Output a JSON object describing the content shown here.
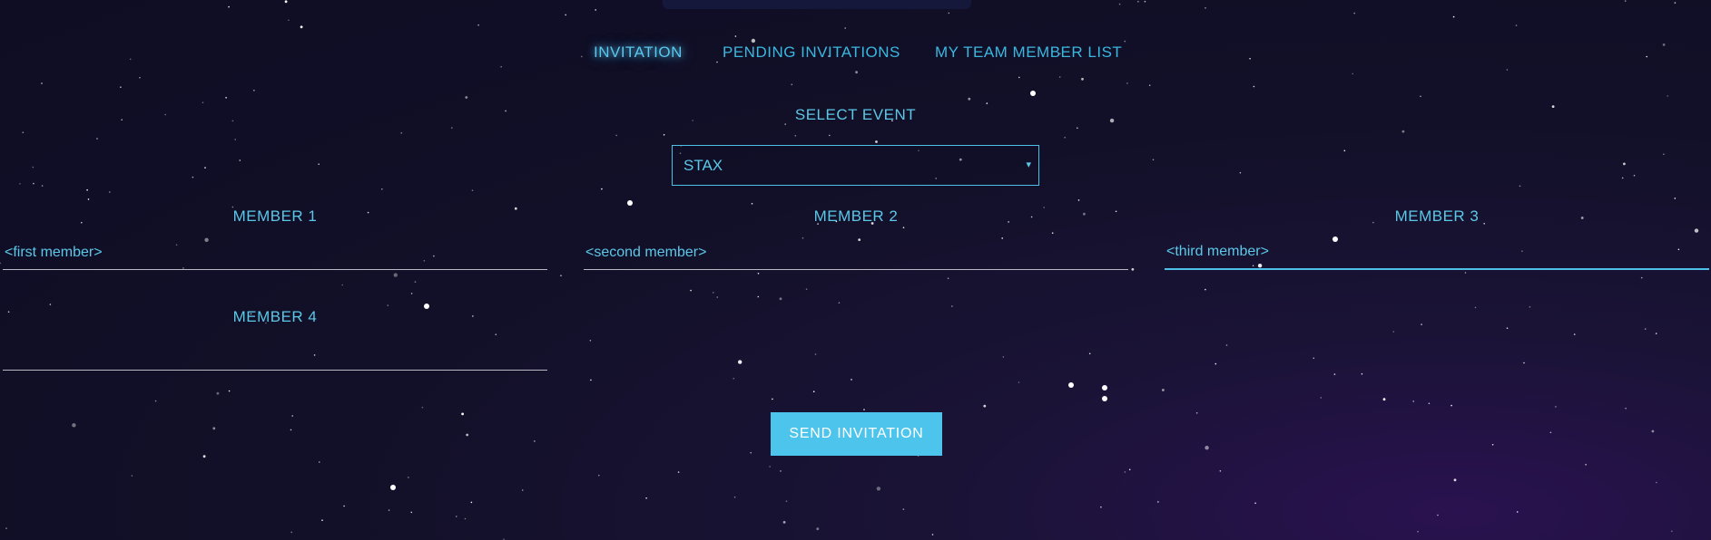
{
  "nav": {
    "items": [
      {
        "label": "INVITATION",
        "active": true
      },
      {
        "label": "PENDING INVITATIONS",
        "active": false
      },
      {
        "label": "MY TEAM MEMBER LIST",
        "active": false
      }
    ]
  },
  "event": {
    "label": "SELECT EVENT",
    "selected": "STAX",
    "caret": "▾"
  },
  "members": [
    {
      "label": "MEMBER 1",
      "value": "",
      "placeholder": "<first member>"
    },
    {
      "label": "MEMBER 2",
      "value": "",
      "placeholder": "<second member>"
    },
    {
      "label": "MEMBER 3",
      "value": "<third member>",
      "placeholder": ""
    },
    {
      "label": "MEMBER 4",
      "value": "",
      "placeholder": ""
    }
  ],
  "send_button": {
    "label": "SEND INVITATION"
  },
  "colors": {
    "accent": "#4cc4ec",
    "text": "#5bc8e8",
    "background": "#121028"
  }
}
